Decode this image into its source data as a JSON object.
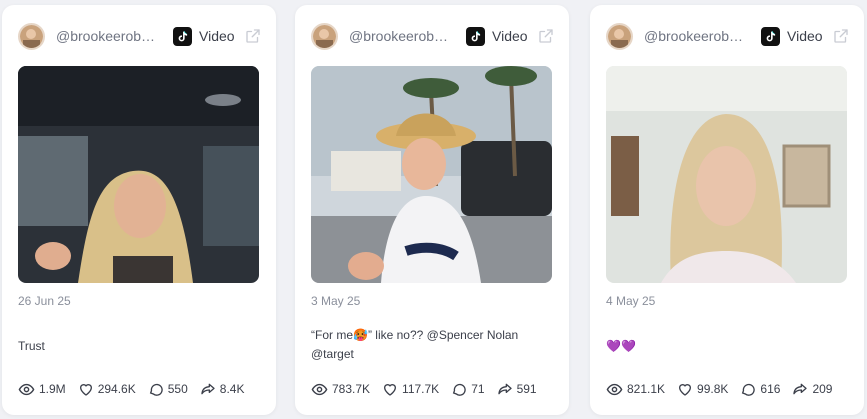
{
  "posts": [
    {
      "username": "@brookeerobe...",
      "platform": "Video",
      "platform_icon": "tiktok-icon",
      "date": "26 Jun 25",
      "caption": "Trust",
      "views": "1.9M",
      "likes": "294.6K",
      "comments": "550",
      "shares": "8.4K"
    },
    {
      "username": "@brookeerobe...",
      "platform": "Video",
      "platform_icon": "tiktok-icon",
      "date": "3 May 25",
      "caption": "“For me🥵” like no?? @Spencer Nolan @target",
      "views": "783.7K",
      "likes": "117.7K",
      "comments": "71",
      "shares": "591"
    },
    {
      "username": "@brookeerobe...",
      "platform": "Video",
      "platform_icon": "tiktok-icon",
      "date": "4 May 25",
      "caption": "💜💜",
      "views": "821.1K",
      "likes": "99.8K",
      "comments": "616",
      "shares": "209"
    }
  ],
  "colors": {
    "background": "#f0f1f5",
    "card": "#ffffff",
    "muted_text": "#8a8f9b",
    "text": "#3b3f4a"
  }
}
